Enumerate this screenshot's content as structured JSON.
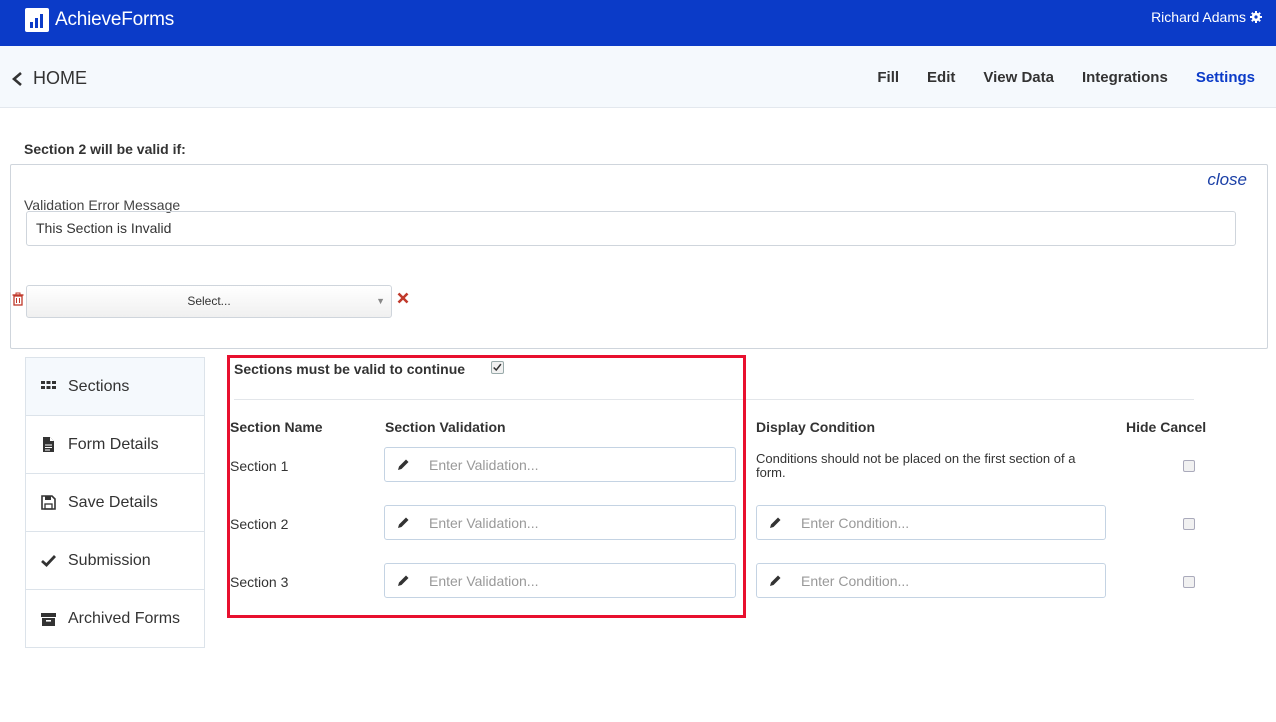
{
  "app": {
    "brand": "AchieveForms",
    "user": "Richard Adams"
  },
  "subnav": {
    "home": "HOME",
    "tabs": [
      {
        "label": "Fill"
      },
      {
        "label": "Edit"
      },
      {
        "label": "View Data"
      },
      {
        "label": "Integrations"
      },
      {
        "label": "Settings",
        "active": true
      }
    ]
  },
  "validation": {
    "title": "Section 2 will be valid if:",
    "close": "close",
    "error_label": "Validation Error Message",
    "error_value": "This Section is Invalid",
    "select_placeholder": "Select..."
  },
  "sidebar": {
    "items": [
      {
        "label": "Sections",
        "icon": "grid-icon",
        "active": true
      },
      {
        "label": "Form Details",
        "icon": "document-icon"
      },
      {
        "label": "Save Details",
        "icon": "floppy-disk-icon"
      },
      {
        "label": "Submission",
        "icon": "checkmark-icon"
      },
      {
        "label": "Archived Forms",
        "icon": "archive-box-icon"
      }
    ]
  },
  "sections": {
    "must_be_valid_label": "Sections must be valid to continue",
    "must_be_valid_checked": true,
    "columns": {
      "name": "Section Name",
      "validation": "Section Validation",
      "condition": "Display Condition",
      "hide_cancel": "Hide Cancel"
    },
    "first_section_note": "Conditions should not be placed on the first section of a form.",
    "validation_placeholder": "Enter Validation...",
    "condition_placeholder": "Enter Condition...",
    "rows": [
      {
        "name": "Section 1",
        "hide_cancel": false
      },
      {
        "name": "Section 2",
        "hide_cancel": false
      },
      {
        "name": "Section 3",
        "hide_cancel": false
      }
    ]
  },
  "colors": {
    "header": "#0b3bc8",
    "active_tab": "#0b3bc8",
    "highlight": "#e8102f"
  }
}
